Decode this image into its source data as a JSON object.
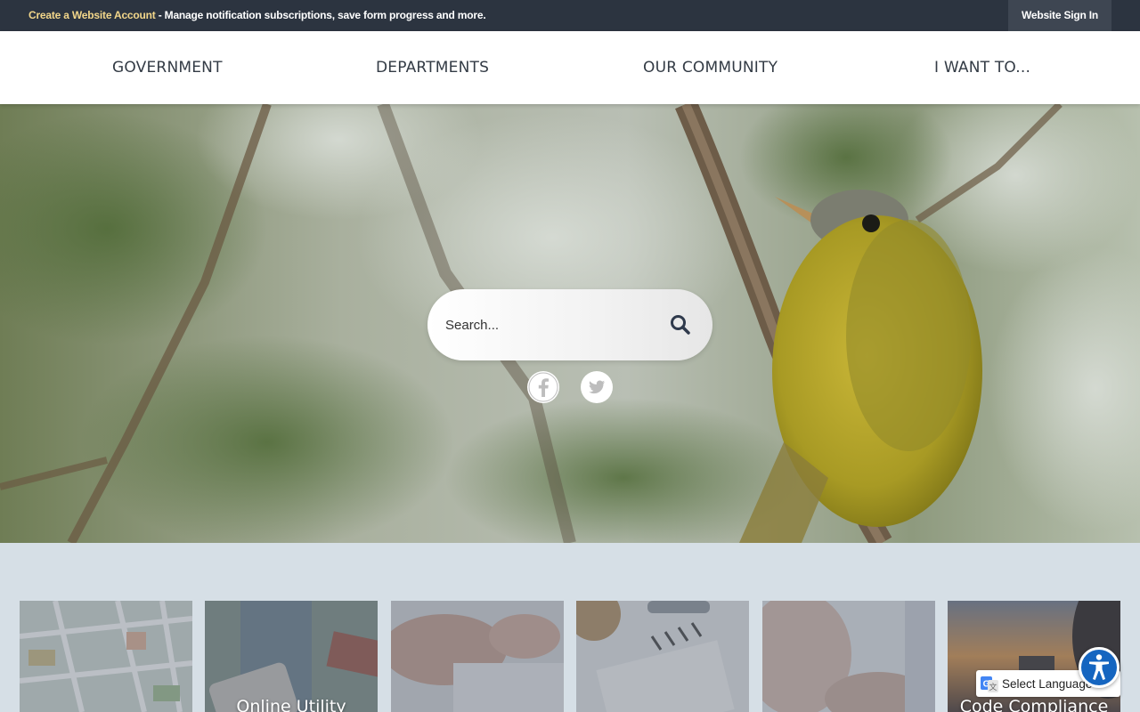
{
  "topbar": {
    "account_link": "Create a Website Account",
    "account_desc": " - Manage notification subscriptions, save form progress and more.",
    "signin_label": "Website Sign In"
  },
  "nav": {
    "items": [
      "GOVERNMENT",
      "DEPARTMENTS",
      "OUR COMMUNITY",
      "I WANT TO..."
    ]
  },
  "search": {
    "placeholder": "Search...",
    "icon": "search-icon"
  },
  "social": {
    "icons": [
      "facebook-icon",
      "twitter-icon"
    ]
  },
  "tiles": {
    "labels": [
      "",
      "Online Utility",
      "",
      "",
      "",
      "Code Compliance"
    ]
  },
  "translate": {
    "label": "Select Language",
    "caret": "▼"
  },
  "colors": {
    "topbar": "#2c3440",
    "account_link": "#f2d68a",
    "nav_text": "#333b45",
    "tile_section_bg": "#d6dfe6",
    "accessibility": "#1565c0"
  }
}
